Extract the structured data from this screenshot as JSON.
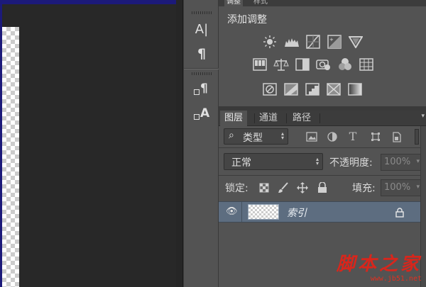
{
  "top_tabs": [
    "调整",
    "样式"
  ],
  "adjustments": {
    "title": "添加调整"
  },
  "layers_panel": {
    "tabs": [
      "图层",
      "通道",
      "路径"
    ],
    "filter": {
      "search_glyph": "⌕",
      "kind_label": "类型"
    },
    "blend_mode": "正常",
    "opacity": {
      "label": "不透明度:",
      "value": "100%"
    },
    "lock_label": "锁定:",
    "fill": {
      "label": "填充:",
      "value": "100%"
    },
    "layer": {
      "name": "索引",
      "visibility_glyph": "👁"
    }
  },
  "tool_strip": {
    "character_glyph": "A|",
    "paragraph_glyph": "¶",
    "para_style_glyph": "¶",
    "char_style_glyph": "A"
  },
  "watermark": {
    "text": "脚本之家",
    "url": "www.jb51.net"
  },
  "colors": {
    "selected_layer": "#5d6d80",
    "panel": "#535353",
    "canvas": "#282828",
    "watermark": "#d8261c"
  }
}
